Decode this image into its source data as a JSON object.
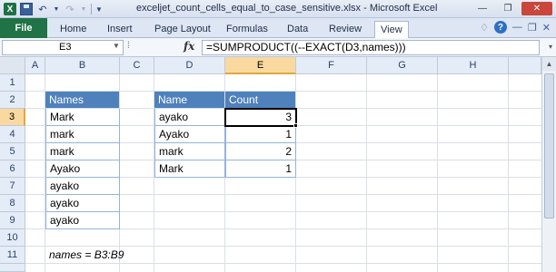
{
  "window": {
    "title": "exceljet_count_cells_equal_to_case_sensitive.xlsx - Microsoft Excel",
    "app_icon": "X"
  },
  "ribbon": {
    "tabs": [
      "File",
      "Home",
      "Insert",
      "Page Layout",
      "Formulas",
      "Data",
      "Review",
      "View"
    ],
    "active_tab": "View"
  },
  "formula_bar": {
    "name_box": "E3",
    "fx": "fx",
    "formula": "=SUMPRODUCT((--EXACT(D3,names)))"
  },
  "grid": {
    "columns": [
      "A",
      "B",
      "C",
      "D",
      "E",
      "F",
      "G",
      "H"
    ],
    "rows": [
      "1",
      "2",
      "3",
      "4",
      "5",
      "6",
      "7",
      "8",
      "9",
      "10",
      "11"
    ],
    "selected_column": "E",
    "selected_row": "3",
    "active_cell": "E3"
  },
  "names_table": {
    "header": "Names",
    "values": [
      "Mark",
      "mark",
      "mark",
      "Ayako",
      "ayako",
      "ayako",
      "ayako"
    ]
  },
  "count_table": {
    "headers": [
      "Name",
      "Count"
    ],
    "rows": [
      {
        "name": "ayako",
        "count": "3"
      },
      {
        "name": "Ayako",
        "count": "1"
      },
      {
        "name": "mark",
        "count": "2"
      },
      {
        "name": "Mark",
        "count": "1"
      }
    ]
  },
  "note": "names = B3:B9",
  "colors": {
    "header_fill": "#4f81bd",
    "file_tab": "#1f7346",
    "selection_header": "#f9d99f"
  }
}
